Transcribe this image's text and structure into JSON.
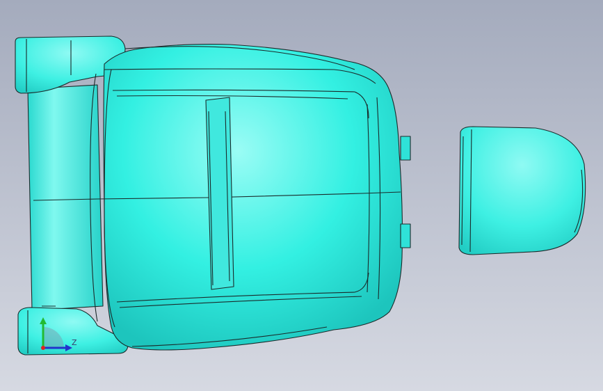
{
  "viewport": {
    "background_top": "#a4abbd",
    "background_bottom": "#d6d9e2"
  },
  "model": {
    "surface_color": "#33f0e2",
    "surface_highlight": "#9afcf5",
    "surface_shadow": "#1dc5bd",
    "edge_color": "#1a2a2a"
  },
  "triad": {
    "y_axis_color": "#22bb33",
    "z_axis_color": "#2233cc",
    "origin_color": "#dd2222",
    "z_label": "Z"
  }
}
